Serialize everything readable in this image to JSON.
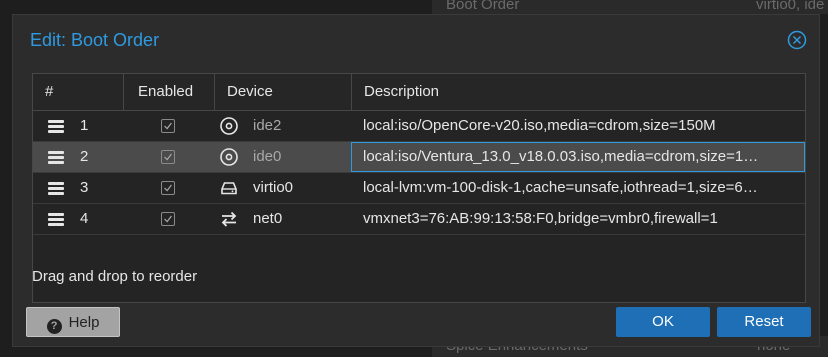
{
  "background": {
    "top_left_item": "Boot Order",
    "top_right_item": "virtio0, ide",
    "bottom_left_item": "Spice Enhancements",
    "bottom_right_item": "none"
  },
  "dialog": {
    "title": "Edit: Boot Order",
    "columns": {
      "index": "#",
      "enabled": "Enabled",
      "device": "Device",
      "description": "Description"
    },
    "rows": [
      {
        "num": "1",
        "device": "ide2",
        "device_icon": "disc-icon",
        "enabled": true,
        "description": "local:iso/OpenCore-v20.iso,media=cdrom,size=150M"
      },
      {
        "num": "2",
        "device": "ide0",
        "device_icon": "disc-icon",
        "enabled": true,
        "description": "local:iso/Ventura_13.0_v18.0.03.iso,media=cdrom,size=1…"
      },
      {
        "num": "3",
        "device": "virtio0",
        "device_icon": "hdd-icon",
        "enabled": true,
        "description": "local-lvm:vm-100-disk-1,cache=unsafe,iothread=1,size=6…"
      },
      {
        "num": "4",
        "device": "net0",
        "device_icon": "network-exchange-icon",
        "enabled": true,
        "description": "vmxnet3=76:AB:99:13:58:F0,bridge=vmbr0,firewall=1"
      }
    ],
    "hint": "Drag and drop to reorder",
    "buttons": {
      "help": "Help",
      "ok": "OK",
      "reset": "Reset"
    }
  },
  "colors": {
    "accent": "#2f9ae0",
    "primary_button": "#1e6fb5",
    "selected_row": "#4b4b4b"
  }
}
